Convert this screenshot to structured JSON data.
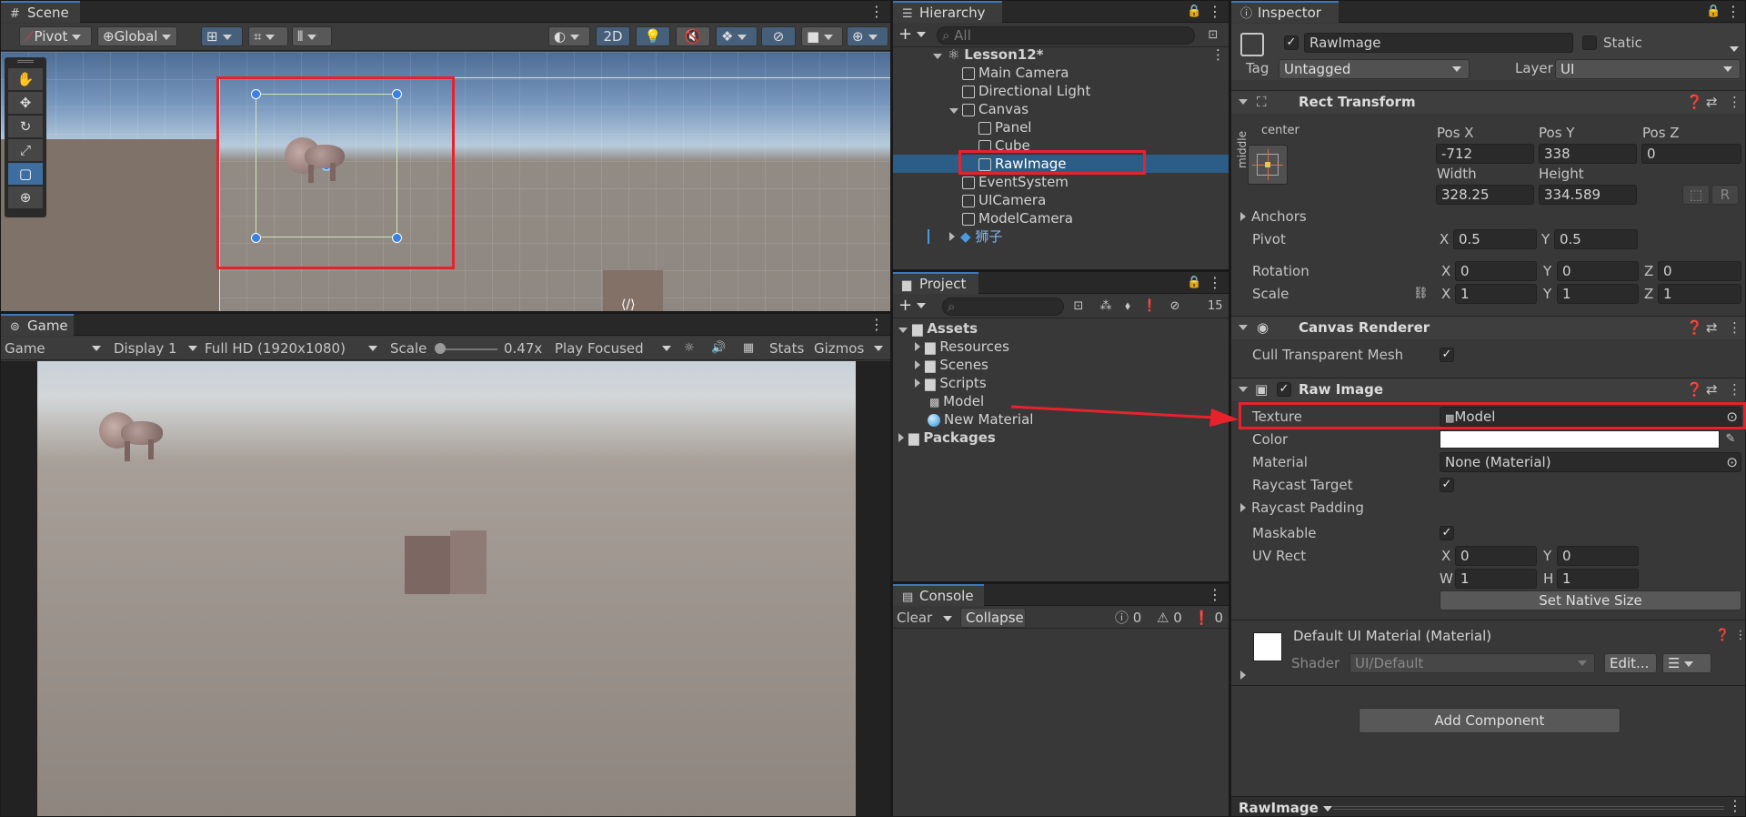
{
  "scene": {
    "tab": "Scene",
    "pivot": "Pivot",
    "global": "Global",
    "mode_2d": "2D"
  },
  "game": {
    "tab": "Game",
    "view": "Game",
    "display": "Display 1",
    "resolution": "Full HD (1920x1080)",
    "scale_label": "Scale",
    "scale_value": "0.47x",
    "play_mode": "Play Focused",
    "stats": "Stats",
    "gizmos": "Gizmos"
  },
  "hierarchy": {
    "tab": "Hierarchy",
    "search_placeholder": "All",
    "items": [
      {
        "label": "Lesson12*"
      },
      {
        "label": "Main Camera"
      },
      {
        "label": "Directional Light"
      },
      {
        "label": "Canvas"
      },
      {
        "label": "Panel"
      },
      {
        "label": "Cube"
      },
      {
        "label": "RawImage"
      },
      {
        "label": "EventSystem"
      },
      {
        "label": "UICamera"
      },
      {
        "label": "ModelCamera"
      },
      {
        "label": "狮子"
      }
    ]
  },
  "project": {
    "tab": "Project",
    "hidden_count": "15",
    "items": [
      {
        "label": "Assets"
      },
      {
        "label": "Resources"
      },
      {
        "label": "Scenes"
      },
      {
        "label": "Scripts"
      },
      {
        "label": "Model"
      },
      {
        "label": "New Material"
      },
      {
        "label": "Packages"
      }
    ]
  },
  "console": {
    "tab": "Console",
    "clear": "Clear",
    "collapse": "Collapse",
    "info_count": "0",
    "warn_count": "0",
    "error_count": "0"
  },
  "inspector": {
    "tab": "Inspector",
    "object_name": "RawImage",
    "static_label": "Static",
    "tag_label": "Tag",
    "tag_value": "Untagged",
    "layer_label": "Layer",
    "layer_value": "UI",
    "rect_transform": {
      "title": "Rect Transform",
      "anchor_h": "center",
      "anchor_v": "middle",
      "posx_label": "Pos X",
      "posx": "-712",
      "posy_label": "Pos Y",
      "posy": "338",
      "posz_label": "Pos Z",
      "posz": "0",
      "width_label": "Width",
      "width": "328.25",
      "height_label": "Height",
      "height": "334.589",
      "r_button": "R",
      "anchors_label": "Anchors",
      "pivot_label": "Pivot",
      "pivot_x": "0.5",
      "pivot_y": "0.5",
      "rotation_label": "Rotation",
      "rot_x": "0",
      "rot_y": "0",
      "rot_z": "0",
      "scale_label": "Scale",
      "scale_x": "1",
      "scale_y": "1",
      "scale_z": "1",
      "x": "X",
      "y": "Y",
      "z": "Z"
    },
    "canvas_renderer": {
      "title": "Canvas Renderer",
      "cull_label": "Cull Transparent Mesh"
    },
    "raw_image": {
      "title": "Raw Image",
      "texture_label": "Texture",
      "texture_value": "Model",
      "color_label": "Color",
      "material_label": "Material",
      "material_value": "None (Material)",
      "raycast_target_label": "Raycast Target",
      "raycast_padding_label": "Raycast Padding",
      "maskable_label": "Maskable",
      "uvrect_label": "UV Rect",
      "uv_x": "0",
      "uv_y": "0",
      "uv_w": "1",
      "uv_h": "1",
      "w": "W",
      "h": "H",
      "set_native": "Set Native Size"
    },
    "material": {
      "title": "Default UI Material (Material)",
      "shader_label": "Shader",
      "shader_value": "UI/Default",
      "edit": "Edit..."
    },
    "add_component": "Add Component",
    "footer_label": "RawImage"
  },
  "colors": {
    "selection": "#2c5d87",
    "accent": "#3a79bb",
    "annotation": "#e8222c"
  }
}
